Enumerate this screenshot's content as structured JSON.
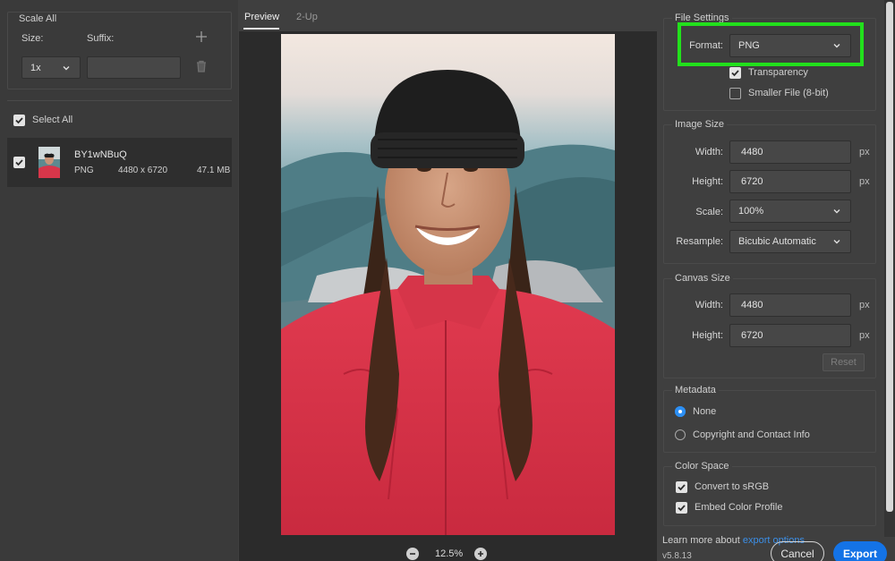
{
  "left": {
    "scale_title": "Scale All",
    "size_label": "Size:",
    "suffix_label": "Suffix:",
    "size_value": "1x",
    "suffix_value": "",
    "select_all_label": "Select All",
    "asset": {
      "name": "BY1wNBuQ",
      "format": "PNG",
      "dimensions": "4480 x 6720",
      "filesize": "47.1 MB"
    }
  },
  "tabs": [
    "Preview",
    "2-Up"
  ],
  "zoom": "12.5%",
  "file_settings": {
    "title": "File Settings",
    "format_label": "Format:",
    "format_value": "PNG",
    "transparency_label": "Transparency",
    "smaller_file_label": "Smaller File (8-bit)"
  },
  "image_size": {
    "title": "Image Size",
    "width_label": "Width:",
    "width_value": "4480",
    "height_label": "Height:",
    "height_value": "6720",
    "scale_label": "Scale:",
    "scale_value": "100%",
    "resample_label": "Resample:",
    "resample_value": "Bicubic Automatic",
    "unit": "px"
  },
  "canvas_size": {
    "title": "Canvas Size",
    "width_label": "Width:",
    "width_value": "4480",
    "height_label": "Height:",
    "height_value": "6720",
    "unit": "px",
    "reset_label": "Reset"
  },
  "metadata": {
    "title": "Metadata",
    "none_label": "None",
    "copyright_label": "Copyright and Contact Info"
  },
  "color_space": {
    "title": "Color Space",
    "convert_label": "Convert to sRGB",
    "embed_label": "Embed Color Profile"
  },
  "footer": {
    "learn_more_prefix": "Learn more about ",
    "learn_more_link": "export options",
    "version": "v5.8.13",
    "cancel": "Cancel",
    "export": "Export"
  },
  "colors": {
    "accent": "#1473e6",
    "highlight": "#22e01c",
    "radio": "#2c8ff4"
  }
}
